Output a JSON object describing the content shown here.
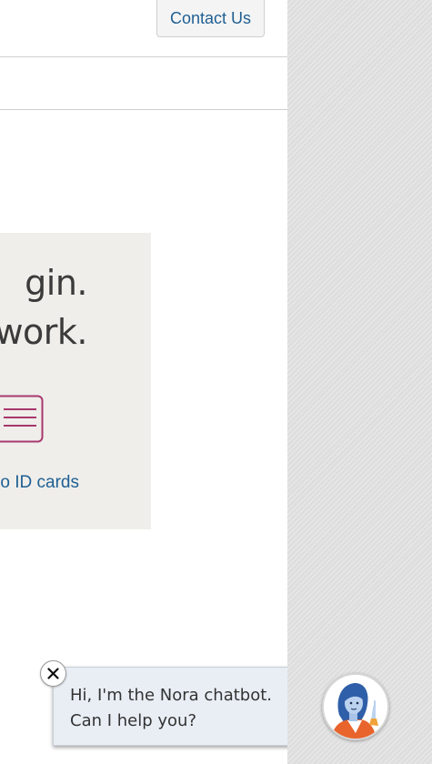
{
  "header": {
    "contact_label": "Contact Us"
  },
  "card": {
    "line1": "gin.",
    "line2": "work.",
    "icon": "id-card-icon",
    "link_text": "o ID cards"
  },
  "chatbot": {
    "greeting_line1": "Hi, I'm the Nora chatbot.",
    "greeting_line2": "Can I help you?",
    "close_icon": "close-icon",
    "avatar_icon": "nora-avatar-icon"
  },
  "colors": {
    "link": "#1f5f93",
    "card_bg": "#efeeea",
    "icon_accent": "#a8386e",
    "chat_bg": "#e9eef5"
  }
}
